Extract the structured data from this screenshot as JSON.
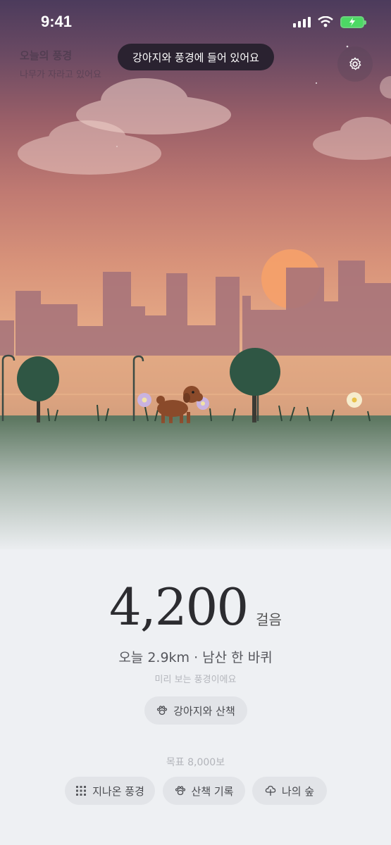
{
  "status_bar": {
    "time": "9:41"
  },
  "scene": {
    "title": "오늘의 풍경",
    "subtitle": "나무가 자라고 있어요",
    "toast": "강아지와 풍경에 들어 있어요",
    "colors": {
      "sky_top": "#4c3b5c",
      "sun": "#f4a06a",
      "ground": "#5e7862"
    }
  },
  "summary": {
    "steps": "4,200",
    "steps_unit": "걸음",
    "today": "오늘 2.9km · 남산 한 바퀴",
    "preview_note": "미리 보는 풍경이에요",
    "walk_button": "강아지와 산책",
    "goal": "목표 8,000보"
  },
  "nav": {
    "past_scenes": "지나온 풍경",
    "walk_log": "산책 기록",
    "my_forest": "나의 숲"
  },
  "icons": {
    "settings": "gear-icon",
    "walk": "paw-icon",
    "past": "grid-icon",
    "log": "paw-icon",
    "forest": "tree-icon"
  }
}
